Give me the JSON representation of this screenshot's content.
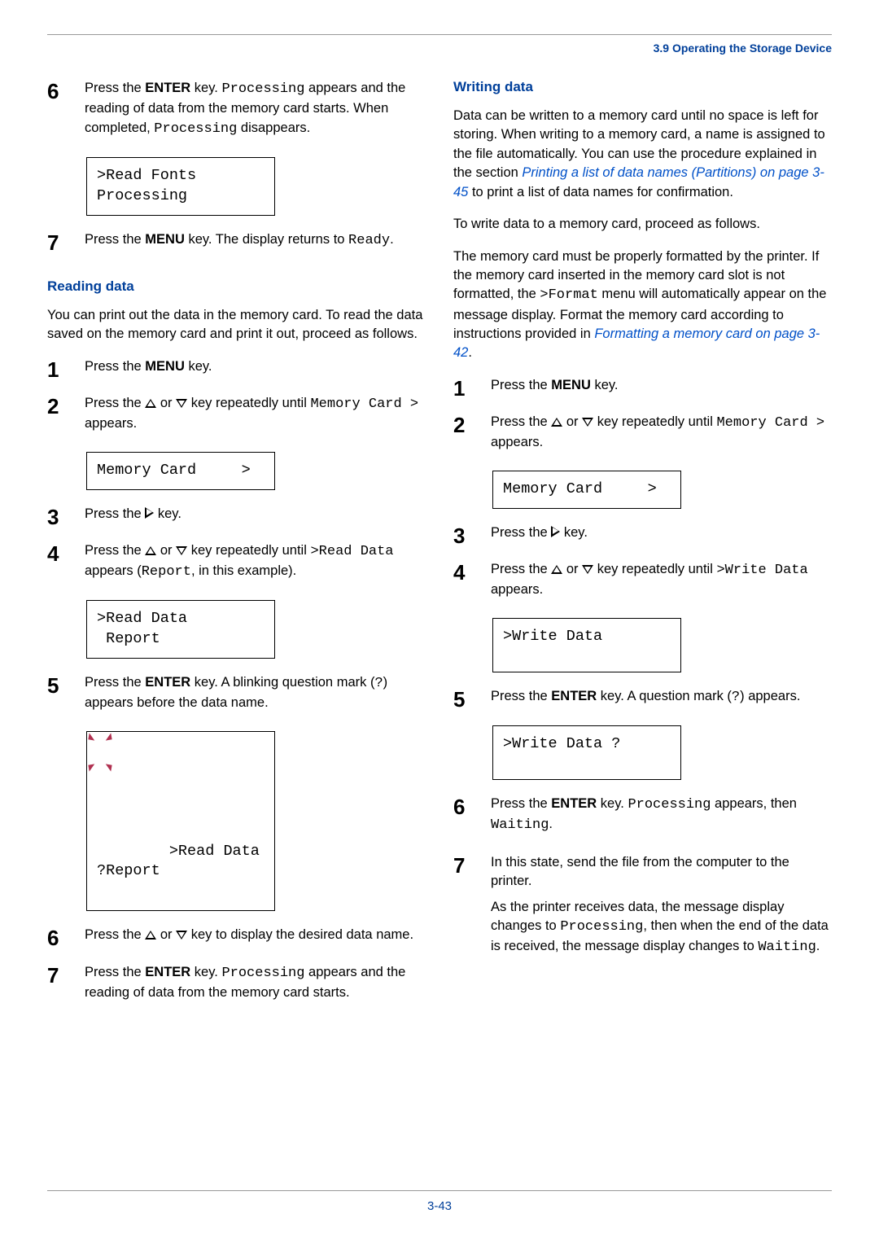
{
  "header": {
    "section": "3.9 Operating the Storage Device"
  },
  "left": {
    "step6": {
      "num": "6",
      "text_a": "Press the ",
      "key": "ENTER",
      "text_b": " key. ",
      "code1": "Processing",
      "text_c": " appears and the reading of data from the memory card starts. When completed, ",
      "code2": "Processing",
      "text_d": " disappears."
    },
    "display1": ">Read Fonts\nProcessing",
    "step7": {
      "num": "7",
      "text_a": "Press the ",
      "key": "MENU",
      "text_b": " key. The display returns to ",
      "code": "Ready",
      "text_c": "."
    },
    "heading_reading": "Reading data",
    "reading_intro": "You can print out the data in the memory card. To read the data saved on the memory card and print it out, proceed as follows.",
    "r_step1": {
      "num": "1",
      "text_a": "Press the ",
      "key": "MENU",
      "text_b": " key."
    },
    "r_step2": {
      "num": "2",
      "text_a": "Press the ",
      "text_b": " or ",
      "text_c": " key repeatedly until ",
      "code1": "Memory Card >",
      "text_d": " appears."
    },
    "display2": "Memory Card     >",
    "r_step3": {
      "num": "3",
      "text_a": "Press the ",
      "text_b": " key."
    },
    "r_step4": {
      "num": "4",
      "text_a": "Press the ",
      "text_b": " or ",
      "text_c": " key repeatedly until ",
      "code1": ">Read Data",
      "text_d": " appears (",
      "code2": "Report",
      "text_e": ", in this example)."
    },
    "display3": ">Read Data\n Report",
    "r_step5": {
      "num": "5",
      "text_a": "Press the ",
      "key": "ENTER",
      "text_b": " key. A blinking question mark (",
      "code": "?",
      "text_c": ") appears before the data name."
    },
    "display4": ">Read Data\n?Report",
    "r_step6": {
      "num": "6",
      "text_a": "Press the ",
      "text_b": " or ",
      "text_c": " key to display the desired data name."
    },
    "r_step7": {
      "num": "7",
      "text_a": "Press the ",
      "key": "ENTER",
      "text_b": " key. ",
      "code": "Processing",
      "text_c": " appears and the reading of data from the memory card starts."
    }
  },
  "right": {
    "heading_writing": "Writing data",
    "writing_intro_a": "Data can be written to a memory card until no space is left for storing. When writing to a memory card, a name is assigned to the file automatically. You can use the procedure explained in the section ",
    "link1": "Printing a list of data names (Partitions) on page 3-45",
    "writing_intro_b": " to print a list of data names for confirmation.",
    "writing_p2": "To write data to a memory card, proceed as follows.",
    "writing_p3_a": "The memory card must be properly formatted by the printer. If the memory card inserted in the memory card slot is not formatted, the ",
    "writing_p3_code": ">Format",
    "writing_p3_b": " menu will automatically appear on the message display. Format the memory card according to instructions provided in ",
    "link2": "Formatting a memory card on page 3-42",
    "writing_p3_c": ".",
    "w_step1": {
      "num": "1",
      "text_a": "Press the ",
      "key": "MENU",
      "text_b": " key."
    },
    "w_step2": {
      "num": "2",
      "text_a": "Press the ",
      "text_b": " or ",
      "text_c": " key repeatedly until ",
      "code1": "Memory Card >",
      "text_d": " appears."
    },
    "display5": "Memory Card     >",
    "w_step3": {
      "num": "3",
      "text_a": "Press the ",
      "text_b": " key."
    },
    "w_step4": {
      "num": "4",
      "text_a": "Press the ",
      "text_b": " or ",
      "text_c": " key repeatedly until ",
      "code1": ">Write Data",
      "text_d": " appears."
    },
    "display6": ">Write Data",
    "w_step5": {
      "num": "5",
      "text_a": "Press the ",
      "key": "ENTER",
      "text_b": " key. A question mark (",
      "code": "?",
      "text_c": ") appears."
    },
    "display7": ">Write Data ?",
    "w_step6": {
      "num": "6",
      "text_a": "Press the ",
      "key": "ENTER",
      "text_b": " key. ",
      "code1": "Processing",
      "text_c": " appears, then ",
      "code2": "Waiting",
      "text_d": "."
    },
    "w_step7": {
      "num": "7",
      "p1": "In this state, send the file from the computer to the printer.",
      "p2_a": "As the printer receives data, the message display changes to ",
      "code1": "Processing",
      "p2_b": ", then when the end of the data is received, the message display changes to ",
      "code2": "Waiting",
      "p2_c": "."
    }
  },
  "footer": {
    "page": "3-43"
  }
}
